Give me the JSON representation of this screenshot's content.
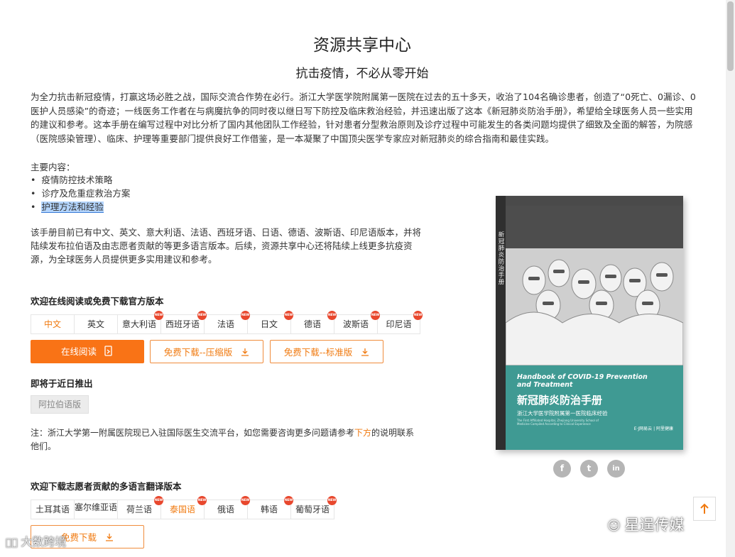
{
  "page": {
    "title": "资源共享中心",
    "subtitle": "抗击疫情，不必从零开始",
    "intro": "为全力抗击新冠疫情，打赢这场必胜之战，国际交流合作势在必行。浙江大学医学院附属第一医院在过去的五十多天，收治了104名确诊患者，创造了“0死亡、0漏诊、0医护人员感染”的奇迹；一线医务工作者在与病魔抗争的同时夜以继日写下防控及临床救治经验，并迅速出版了这本《新冠肺炎防治手册》，希望给全球医务人员一些实用的建议和参考。这本手册在编写过程中对比分析了国内其他团队工作经验，针对患者分型救治原则及诊疗过程中可能发生的各类问题均提供了细致及全面的解答，为院感（医院感染管理）、临床、护理等重要部门提供良好工作借鉴，是一本凝聚了中国顶尖医学专家应对新冠肺炎的综合指南和最佳实践。",
    "main_content_title": "主要内容：",
    "bullets": [
      "疫情防控技术策略",
      "诊疗及危重症救治方案",
      "护理方法和经验"
    ],
    "para2": "该手册目前已有中文、英文、意大利语、法语、西班牙语、日语、德语、波斯语、印尼语版本，并将陆续发布拉伯语及由志愿者贡献的等更多语言版本。后续，资源共享中心还将陆续上线更多抗疫资源，为全球医务人员提供更多实用建议和参考。"
  },
  "official": {
    "title": "欢迎在线阅读或免费下载官方版本",
    "languages": [
      {
        "label": "中文",
        "new": false,
        "active": true
      },
      {
        "label": "英文",
        "new": false,
        "active": false
      },
      {
        "label": "意大利语",
        "new": true,
        "active": false
      },
      {
        "label": "西班牙语",
        "new": true,
        "active": false
      },
      {
        "label": "法语",
        "new": true,
        "active": false
      },
      {
        "label": "日文",
        "new": true,
        "active": false
      },
      {
        "label": "德语",
        "new": true,
        "active": false
      },
      {
        "label": "波斯语",
        "new": true,
        "active": false
      },
      {
        "label": "印尼语",
        "new": true,
        "active": false
      }
    ],
    "read_online": "在线阅读",
    "download_compressed": "免费下载--压缩版",
    "download_standard": "免费下载--标准版"
  },
  "coming_soon": {
    "title": "即将于近日推出",
    "item": "阿拉伯语版"
  },
  "note": {
    "prefix": "注：浙江大学第一附属医院现已入驻国际医生交流平台，如您需要咨询更多问题请参考",
    "link": "下方",
    "suffix": "的说明联系他们。"
  },
  "volunteer": {
    "title": "欢迎下载志愿者贡献的多语言翻译版本",
    "languages": [
      {
        "label": "土耳其语",
        "new": false,
        "active": false
      },
      {
        "label": "塞尔维亚语",
        "new": false,
        "active": false
      },
      {
        "label": "荷兰语",
        "new": true,
        "active": false
      },
      {
        "label": "泰国语",
        "new": true,
        "active": true
      },
      {
        "label": "俄语",
        "new": true,
        "active": false
      },
      {
        "label": "韩语",
        "new": true,
        "active": false
      },
      {
        "label": "葡萄牙语",
        "new": true,
        "active": false
      }
    ],
    "download": "免费下载"
  },
  "badge_text": "NEW",
  "book": {
    "spine": "新冠肺炎防治手册",
    "en_title": "Handbook of COVID-19 Prevention and Treatment",
    "cn_title": "新冠肺炎防治手册",
    "sub": "浙江大学医学院附属第一医院临床经验",
    "en_sub": "The First Affiliated Hospital, Zhejiang University School of Medicine Compiled According to Clinical Experience",
    "logos": "E·J网易云 | 阿里健康"
  },
  "social": [
    "f",
    "t",
    "in"
  ],
  "watermarks": {
    "left": "大数跨境",
    "right": "星逞传媒"
  },
  "colors": {
    "accent": "#f97316",
    "badge": "#e8472d",
    "cover_band": "#3f9a93"
  }
}
